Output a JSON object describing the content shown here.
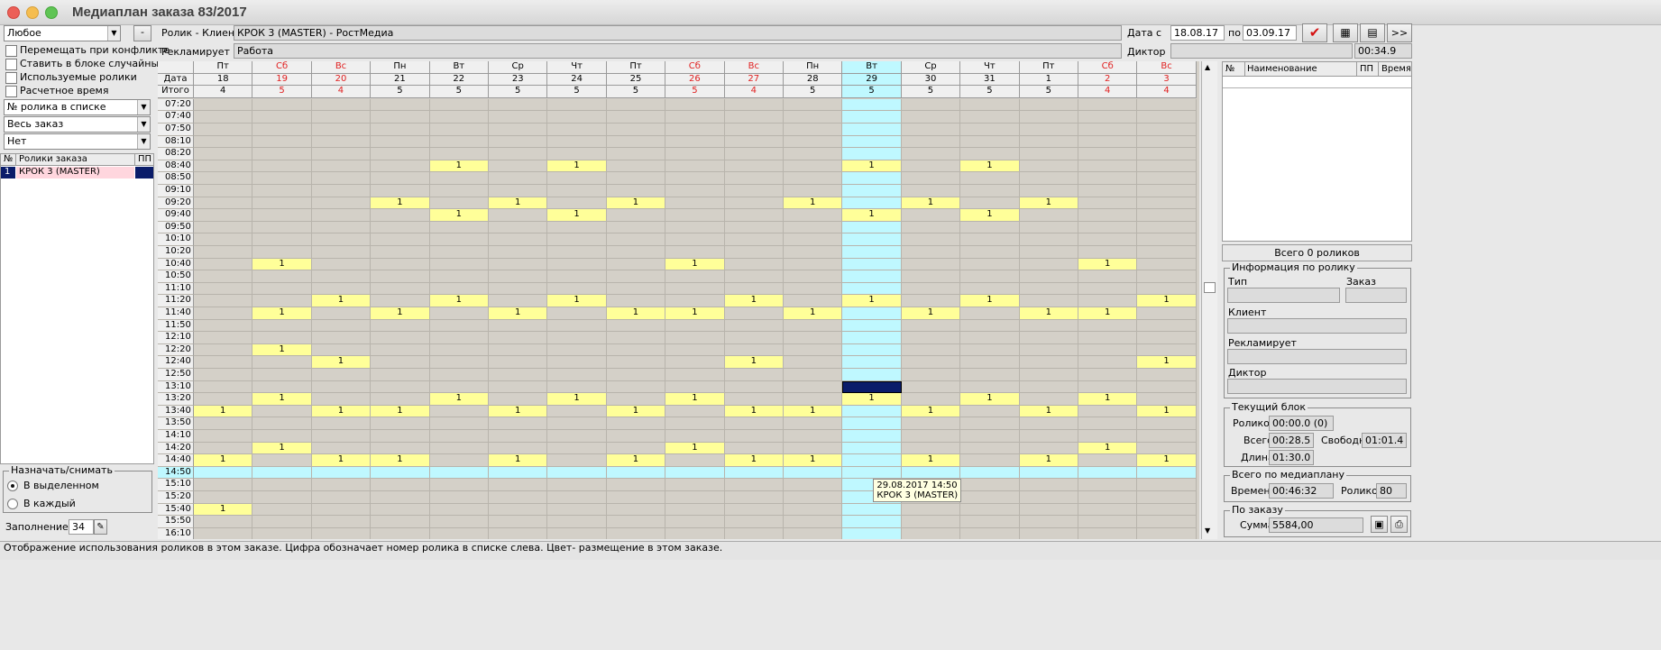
{
  "window": {
    "title": "Медиаплан заказа 83/2017"
  },
  "left": {
    "filter_select": "Любое",
    "minus_label": "-",
    "checkboxes": [
      "Перемещать при конфликте",
      "Ставить в блоке случайным",
      "Используемые ролики",
      "Расчетное время"
    ],
    "sort_select": "№ ролика в списке",
    "scope_select": "Весь заказ",
    "third_select": "Нет",
    "table_headers": {
      "num": "№",
      "name": "Ролики заказа",
      "pp": "ПП"
    },
    "rows": [
      {
        "num": "1",
        "name": "КРОК 3 (MASTER)",
        "pp": ""
      }
    ],
    "assign_group": "Назначать/снимать",
    "radio_selected": "В выделенном",
    "radio_each": "В каждый",
    "fill_label": "Заполнение",
    "fill_value": "34"
  },
  "header": {
    "clip_client_label": "Ролик - Клиент",
    "clip_client_value": "КРОК 3 (MASTER) - РостМедиа",
    "advertises_label": "Рекламирует",
    "advertises_value": "Работа",
    "date_from_label": "Дата с",
    "date_from": "18.08.17",
    "date_to_label": "по",
    "date_to": "03.09.17",
    "announcer_label": "Диктор",
    "duration": "00:34.9",
    "more_label": ">>"
  },
  "grid": {
    "row_labels": {
      "weekday": "",
      "date": "Дата",
      "total": "Итого"
    },
    "columns": [
      {
        "wd": "Пт",
        "d": "18",
        "t": "4",
        "we": false
      },
      {
        "wd": "Сб",
        "d": "19",
        "t": "5",
        "we": true
      },
      {
        "wd": "Вс",
        "d": "20",
        "t": "4",
        "we": true
      },
      {
        "wd": "Пн",
        "d": "21",
        "t": "5",
        "we": false
      },
      {
        "wd": "Вт",
        "d": "22",
        "t": "5",
        "we": false
      },
      {
        "wd": "Ср",
        "d": "23",
        "t": "5",
        "we": false
      },
      {
        "wd": "Чт",
        "d": "24",
        "t": "5",
        "we": false
      },
      {
        "wd": "Пт",
        "d": "25",
        "t": "5",
        "we": false
      },
      {
        "wd": "Сб",
        "d": "26",
        "t": "5",
        "we": true
      },
      {
        "wd": "Вс",
        "d": "27",
        "t": "4",
        "we": true
      },
      {
        "wd": "Пн",
        "d": "28",
        "t": "5",
        "we": false
      },
      {
        "wd": "Вт",
        "d": "29",
        "t": "5",
        "we": false,
        "current": true
      },
      {
        "wd": "Ср",
        "d": "30",
        "t": "5",
        "we": false
      },
      {
        "wd": "Чт",
        "d": "31",
        "t": "5",
        "we": false
      },
      {
        "wd": "Пт",
        "d": "1",
        "t": "5",
        "we": false
      },
      {
        "wd": "Сб",
        "d": "2",
        "t": "4",
        "we": true
      },
      {
        "wd": "Вс",
        "d": "3",
        "t": "4",
        "we": true
      }
    ],
    "times": [
      "07:20",
      "07:40",
      "07:50",
      "08:10",
      "08:20",
      "08:40",
      "08:50",
      "09:10",
      "09:20",
      "09:40",
      "09:50",
      "10:10",
      "10:20",
      "10:40",
      "10:50",
      "11:10",
      "11:20",
      "11:40",
      "11:50",
      "12:10",
      "12:20",
      "12:40",
      "12:50",
      "13:10",
      "13:20",
      "13:40",
      "13:50",
      "14:10",
      "14:20",
      "14:40",
      "14:50",
      "15:10",
      "15:20",
      "15:40",
      "15:50",
      "16:10"
    ],
    "placements": {
      "08:40": [
        4,
        6,
        11,
        13
      ],
      "09:20": [
        3,
        5,
        7,
        10,
        12,
        14
      ],
      "09:40": [
        4,
        6,
        11,
        13
      ],
      "10:40": [
        1,
        8,
        15
      ],
      "11:20": [
        2,
        4,
        6,
        9,
        11,
        13,
        16
      ],
      "11:40": [
        1,
        3,
        5,
        7,
        8,
        10,
        12,
        14,
        15
      ],
      "12:20": [
        1
      ],
      "12:40": [
        2,
        9,
        16
      ],
      "13:20": [
        1,
        4,
        6,
        8,
        11,
        13,
        15
      ],
      "13:40": [
        0,
        2,
        3,
        5,
        7,
        9,
        10,
        12,
        14,
        16
      ],
      "14:20": [
        1,
        8,
        15
      ],
      "14:40": [
        0,
        2,
        3,
        5,
        7,
        9,
        10,
        12,
        14,
        16
      ],
      "15:40": [
        0
      ]
    },
    "placement_value": "1",
    "selected_slot": {
      "time": "13:10",
      "col": 11
    },
    "highlight_time": "14:50",
    "tooltip_line1": "29.08.2017 14:50",
    "tooltip_line2": "КРОК 3 (MASTER)"
  },
  "right": {
    "table_headers": {
      "num": "№",
      "name": "Наименование",
      "pp": "ПП",
      "time": "Время"
    },
    "total_clips": "Всего 0 роликов",
    "info_group": "Информация по ролику",
    "type_label": "Тип",
    "order_label": "Заказ",
    "client_label": "Клиент",
    "advertises_label": "Рекламирует",
    "announcer_label": "Диктор",
    "block_group": "Текущий блок",
    "clips_label": "Роликов",
    "clips_value": "00:00.0 (0)",
    "total_label": "Всего",
    "total_value": "00:28.5",
    "free_label": "Свободно",
    "free_value": "01:01.4",
    "length_label": "Длина",
    "length_value": "01:30.0",
    "plan_group": "Всего по медиаплану",
    "time_label": "Времени",
    "time_value": "00:46:32",
    "plan_clips_label": "Роликов",
    "plan_clips_value": "80",
    "order_group": "По заказу",
    "sum_label": "Сумма",
    "sum_value": "5584,00"
  },
  "status": "Отображение использования роликов в этом заказе. Цифра обозначает номер ролика в списке слева. Цвет- размещение в этом заказе.",
  "colors": {
    "placement": "#ffff99",
    "current_col": "#bff8ff",
    "selected": "#0a1c6a",
    "weekend": "#e02020"
  }
}
